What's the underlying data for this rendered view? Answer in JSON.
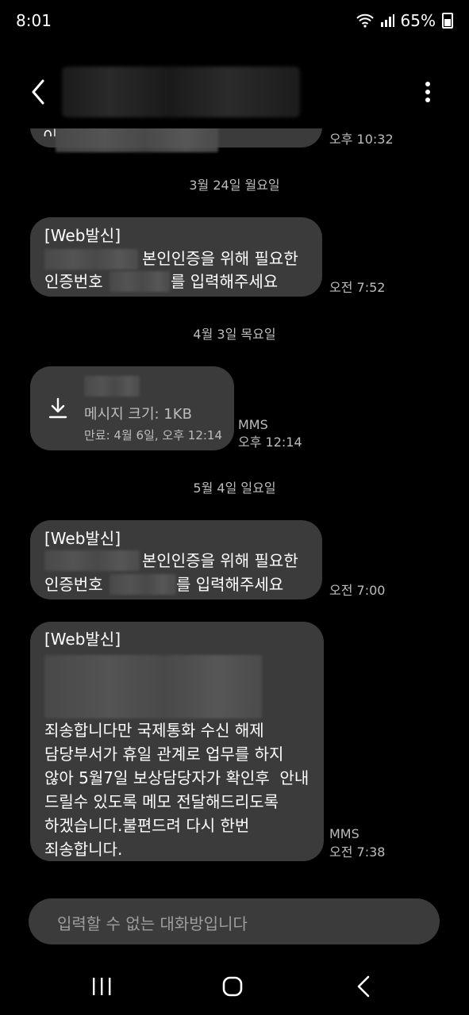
{
  "status_bar": {
    "time": "8:01",
    "battery": "65%"
  },
  "header": {
    "contact": ""
  },
  "messages": [
    {
      "id": "m0",
      "text": "이",
      "time": "오후 10:32"
    },
    {
      "id": "m1",
      "date": "3월 24일 월요일",
      "line1_prefix": "[Web발신]",
      "line2": "본인인증을 위해 필요한",
      "line3_a": "인증번호",
      "line3_b": "를 입력해주세요",
      "time": "오전 7:52"
    },
    {
      "id": "m2",
      "date": "4월 3일 목요일",
      "size_label": "메시지 크기: 1KB",
      "expiry": "만료: 4월 6일, 오후 12:14",
      "type": "MMS",
      "time": "오후 12:14"
    },
    {
      "id": "m3",
      "date": "5월 4일 일요일",
      "line1_prefix": "[Web발신]",
      "line2": "본인인증을 위해 필요한",
      "line3_a": "인증번호",
      "line3_b": "를 입력해주세요",
      "time": "오전 7:00"
    },
    {
      "id": "m4",
      "line1": "[Web발신]",
      "body": [
        "죄송합니다만 국제통화 수신 해제",
        "담당부서가 휴일 관계로 업무를 하지",
        "않아 5월7일 보상담당자가 확인후  안내",
        "드릴수 있도록 메모 전달해드리도록",
        "하겠습니다.불편드려 다시 한번",
        "죄송합니다."
      ],
      "type": "MMS",
      "time": "오전 7:38"
    }
  ],
  "input": {
    "placeholder": "입력할 수 없는 대화방입니다"
  },
  "nav": {
    "recents": "recents-icon",
    "home": "home-icon",
    "back": "back-icon"
  }
}
